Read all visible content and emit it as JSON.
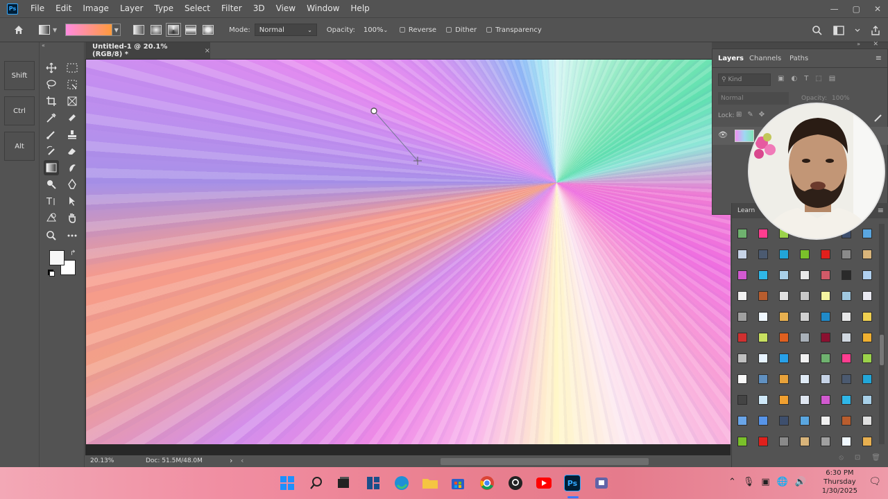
{
  "menubar": {
    "logo": "Ps",
    "items": [
      "File",
      "Edit",
      "Image",
      "Layer",
      "Type",
      "Select",
      "Filter",
      "3D",
      "View",
      "Window",
      "Help"
    ],
    "window_controls": [
      "—",
      "▢",
      "✕"
    ]
  },
  "options": {
    "mode_label": "Mode:",
    "mode_value": "Normal",
    "opacity_label": "Opacity:",
    "opacity_value": "100%",
    "reverse_label": "Reverse",
    "dither_label": "Dither",
    "transparency_label": "Transparency",
    "gradient_colors": [
      "#ff8be0",
      "#ff9a3c"
    ]
  },
  "modifier_keys": [
    "Shift",
    "Ctrl",
    "Alt"
  ],
  "document": {
    "tab_title": "Untitled-1 @ 20.1% (RGB/8) *",
    "close": "×",
    "zoom": "20.13%",
    "doc_info": "Doc: 51.5M/48.0M",
    "status_arrow_right": "›",
    "status_arrow_left": "‹"
  },
  "layers_panel": {
    "tabs": [
      "Layers",
      "Channels",
      "Paths"
    ],
    "search_placeholder": "Kind",
    "blend_mode": "Normal",
    "opacity_label": "Opacity:",
    "opacity_value": "100%",
    "lock_label": "Lock:"
  },
  "learn_panel": {
    "title": "Learn"
  },
  "taskbar": {
    "time": "6:30 PM",
    "day": "Thursday",
    "date": "1/30/2025"
  },
  "colors": {
    "foreground": "#f7f7f7",
    "background": "#ffffff",
    "accent": "#31a8ff"
  }
}
